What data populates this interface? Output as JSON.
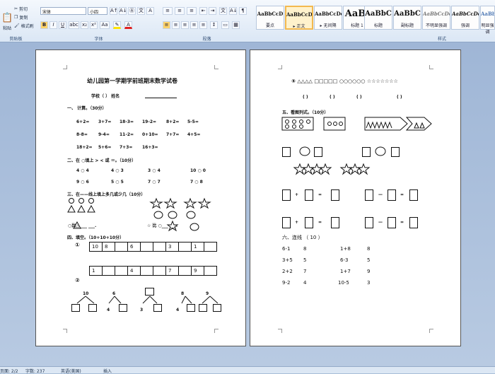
{
  "ribbon": {
    "clipboard": {
      "paste": "粘贴",
      "cut": "剪切",
      "copy": "复制",
      "format_painter": "格式刷",
      "label": "剪贴板"
    },
    "font": {
      "family": "宋体",
      "size": "小四",
      "label": "字体",
      "b": "B",
      "i": "I",
      "u": "U",
      "abc": "abc",
      "x2": "x₂",
      "x2up": "x²",
      "aa": "Aa",
      "grow": "A↑",
      "shrink": "A↓",
      "clear": "Ⓐ",
      "wen": "文",
      "char": "A"
    },
    "paragraph": {
      "label": "段落",
      "bullets": "≡",
      "numbers": "≡",
      "outline": "≡",
      "decrease": "⇤",
      "increase": "⇥",
      "cn": "文",
      "sort": "A↓",
      "marks": "¶",
      "align_left": "≡",
      "center": "≡",
      "align_right": "≡",
      "justify": "≡",
      "distribute": "≡",
      "spacing": "↕",
      "shade": "▭",
      "border": "▦"
    },
    "styles": [
      {
        "sample": "AaBbCcD",
        "name": "要点"
      },
      {
        "sample": "AaBbCcDc",
        "name": "▸ 正文"
      },
      {
        "sample": "AaBbCcDc",
        "name": "▸ 无间隔"
      },
      {
        "sample": "AaBl",
        "name": "标题 1"
      },
      {
        "sample": "AaBbC",
        "name": "标题"
      },
      {
        "sample": "AaBbC",
        "name": "副标题"
      },
      {
        "sample": "AaBbCcDc",
        "name": "不明显强调"
      },
      {
        "sample": "AaBbCcDc",
        "name": "强调"
      },
      {
        "sample": "AaBbCcD",
        "name": "明显强调"
      }
    ],
    "styles_label": "样式"
  },
  "status": {
    "page": "页面: 2/2",
    "words": "字数: 237",
    "lang": "英语(美国)",
    "insert": "插入"
  },
  "page1": {
    "title": "幼儿园第一学期学前班期末数学试卷",
    "student": "学校（   ）                 姓名",
    "sec1": "一、    计算。（30分）",
    "calc": [
      [
        "6+2=",
        "3+7=",
        "18-3=",
        "19-2=",
        "8+2=",
        "5-5="
      ],
      [
        "8-8=",
        "9-4=",
        "11-2=",
        "0+10=",
        "7+7=",
        "4+5="
      ],
      [
        "18+2=",
        "5+6=",
        "7+3=",
        "16+3="
      ]
    ],
    "sec2": "二、在 ○填上 >  <  或 ＝。（10分）",
    "compare": [
      "4 ○ 4",
      "4 ○ 3",
      "3 ○ 4",
      "10 ○ 0",
      "9 ○ 6",
      "5 ○ 5",
      "7 ○ 7",
      "7 ○ 8"
    ],
    "sec3": "三、在——线上填上多几或少几（10分）",
    "cmp1": "○比△  ___ ___.",
    "cmp2": "☆ 比 ○___  ___.",
    "sec4": "四、填空。（10+10+10分）",
    "q1": "①",
    "q2": "②",
    "row1": [
      "10",
      "8",
      "",
      "6",
      "",
      "",
      "3",
      "",
      "1",
      ""
    ],
    "row2": [
      "1",
      "",
      "",
      "4",
      "",
      "",
      "7",
      "",
      "9",
      ""
    ],
    "split": [
      "10",
      "6",
      "4",
      "3",
      "4",
      "8",
      "9"
    ]
  },
  "page2": {
    "line1": "⑤  △△△△     □□□□□    ○○○○○○      ☆☆☆☆☆☆☆",
    "brackets": [
      "(    )",
      "(    )",
      "(    )",
      "(    )"
    ],
    "sec5": "五、看图列式。（10分）",
    "ops": [
      "+",
      "=",
      "—",
      "=",
      "+",
      "=",
      "—",
      "="
    ],
    "sec6": "六、连线  （ 10 ）",
    "lines": [
      [
        "6-1",
        "8",
        "1+8",
        "8"
      ],
      [
        "3+5",
        "5",
        "6-3",
        "5"
      ],
      [
        "2+2",
        "7",
        "1+7",
        "9"
      ],
      [
        "9-2",
        "4",
        "10-5",
        "3"
      ]
    ]
  }
}
